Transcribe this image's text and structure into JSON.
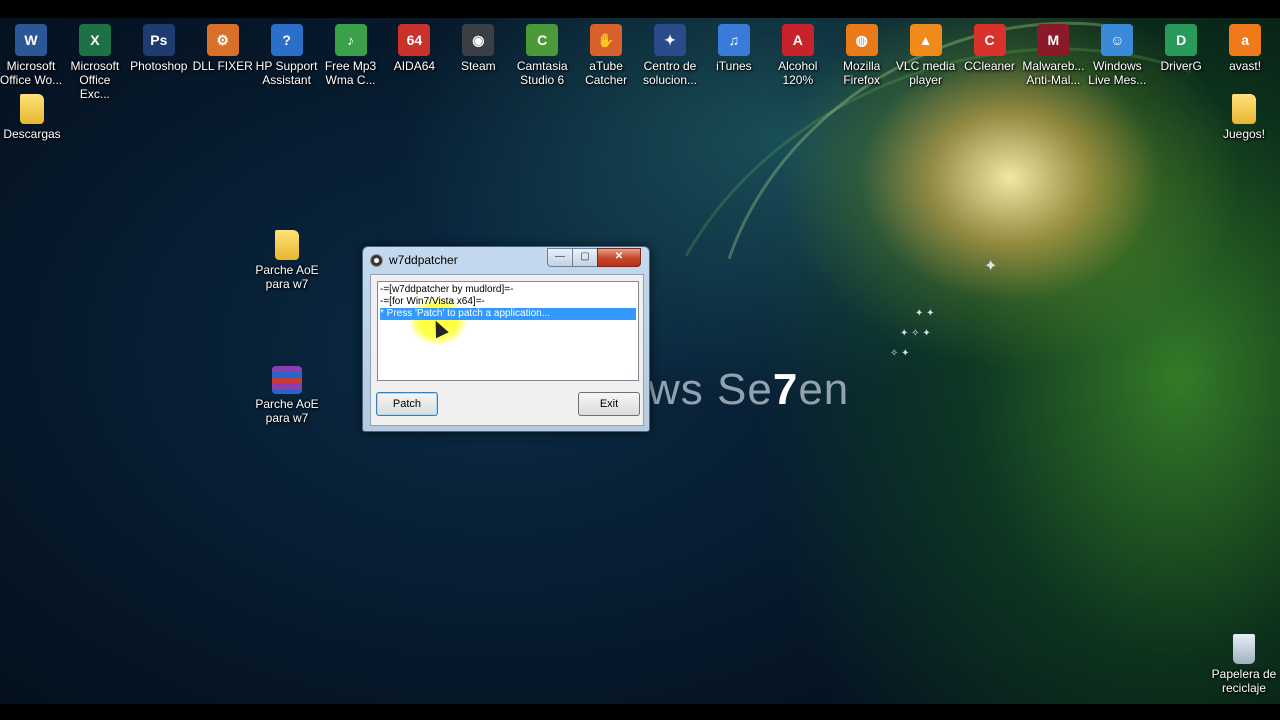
{
  "desktop": {
    "top_icons": [
      {
        "label": "Microsoft Office Wo...",
        "icon": "word-icon",
        "color": "#2b5797",
        "glyph": "W"
      },
      {
        "label": "Microsoft Office Exc...",
        "icon": "excel-icon",
        "color": "#1e7145",
        "glyph": "X"
      },
      {
        "label": "Photoshop",
        "icon": "photoshop-icon",
        "color": "#1d3b6e",
        "glyph": "Ps"
      },
      {
        "label": "DLL FIXER",
        "icon": "dll-fixer-icon",
        "color": "#d8702a",
        "glyph": "⚙"
      },
      {
        "label": "HP Support Assistant",
        "icon": "hp-support-icon",
        "color": "#2a6fc8",
        "glyph": "?"
      },
      {
        "label": "Free Mp3 Wma C...",
        "icon": "mp3-converter-icon",
        "color": "#3aa04a",
        "glyph": "♪"
      },
      {
        "label": "AIDA64",
        "icon": "aida64-icon",
        "color": "#c8322a",
        "glyph": "64"
      },
      {
        "label": "Steam",
        "icon": "steam-icon",
        "color": "#3a3f46",
        "glyph": "◉"
      },
      {
        "label": "Camtasia Studio 6",
        "icon": "camtasia-icon",
        "color": "#4a9a3a",
        "glyph": "C"
      },
      {
        "label": "aTube Catcher",
        "icon": "atube-catcher-icon",
        "color": "#d8602a",
        "glyph": "✋"
      },
      {
        "label": "Centro de solucion...",
        "icon": "solutions-center-icon",
        "color": "#2a4a8a",
        "glyph": "✦"
      },
      {
        "label": "iTunes",
        "icon": "itunes-icon",
        "color": "#3a7ad8",
        "glyph": "♫"
      },
      {
        "label": "Alcohol 120%",
        "icon": "alcohol-icon",
        "color": "#c8222a",
        "glyph": "A"
      },
      {
        "label": "Mozilla Firefox",
        "icon": "firefox-icon",
        "color": "#e87a1a",
        "glyph": "◍"
      },
      {
        "label": "VLC media player",
        "icon": "vlc-icon",
        "color": "#f08a1a",
        "glyph": "▲"
      },
      {
        "label": "CCleaner",
        "icon": "ccleaner-icon",
        "color": "#d8322a",
        "glyph": "C"
      },
      {
        "label": "Malwareb... Anti-Mal...",
        "icon": "malwarebytes-icon",
        "color": "#8a1a2a",
        "glyph": "M"
      },
      {
        "label": "Windows Live Mes...",
        "icon": "live-messenger-icon",
        "color": "#3a8ad8",
        "glyph": "☺"
      },
      {
        "label": "DriverG",
        "icon": "driverg-icon",
        "color": "#2a9a5a",
        "glyph": "D"
      },
      {
        "label": "avast!",
        "icon": "avast-icon",
        "color": "#f07a1a",
        "glyph": "a"
      }
    ],
    "descargas": "Descargas",
    "juegos": "Juegos!",
    "parche_folder": "Parche AoE para w7",
    "parche_rar": "Parche AoE para w7",
    "recycle_bin": "Papelera de reciclaje",
    "wallpaper_text_a": "ws Se",
    "wallpaper_text_b": "7",
    "wallpaper_text_c": "en"
  },
  "window": {
    "title": "w7ddpatcher",
    "minimize_glyph": "—",
    "maximize_glyph": "▢",
    "close_glyph": "✕",
    "log_lines": [
      "-=[w7ddpatcher by mudlord]=-",
      "-=[for  Win7/Vista x64]=-",
      "* Press 'Patch' to patch a application..."
    ],
    "patch_label": "Patch",
    "exit_label": "Exit",
    "highlight_color": "#ffff3c"
  }
}
